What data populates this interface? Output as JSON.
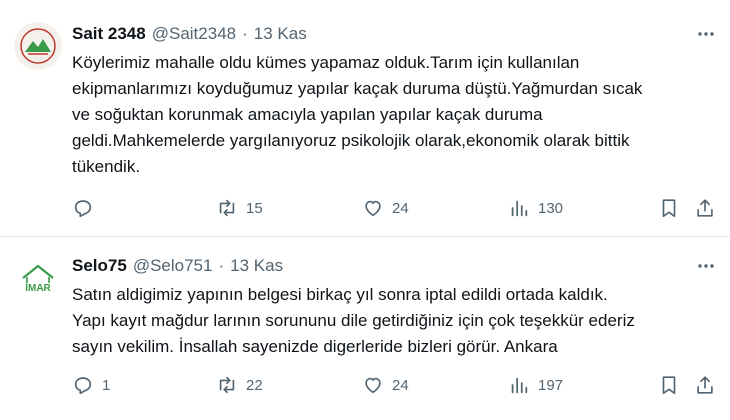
{
  "tweets": [
    {
      "name": "Sait 2348",
      "handle": "@Sait2348",
      "separator": "·",
      "time": "13 Kas",
      "text": "Köylerimiz mahalle oldu kümes yapamaz olduk.Tarım için kullanılan\nekipmanlarımızı koyduğumuz yapılar kaçak duruma düştü.Yağmurdan sıcak\nve soğuktan korunmak amacıyla yapılan yapılar kaçak duruma\ngeldi.Mahkemelerde yargılanıyoruz psikolojik olarak,ekonomik olarak bittik\ntükendik.",
      "reply_count": "",
      "retweet_count": "15",
      "like_count": "24",
      "view_count": "130"
    },
    {
      "name": "Selo75",
      "handle": "@Selo751",
      "separator": "·",
      "time": "13 Kas",
      "avatar_text": "İMAR",
      "text": "Satın aldigimiz yapının belgesi birkaç yıl sonra iptal edildi ortada kaldık.\nYapı kayıt mağdur larının sorununu dile getirdiğiniz için çok teşekkür ederiz\nsayın vekilim. İnsallah sayenizde digerleride bizleri görür. Ankara",
      "reply_count": "1",
      "retweet_count": "22",
      "like_count": "24",
      "view_count": "197"
    }
  ],
  "icons": {
    "more": "more-horizontal-icon",
    "reply": "reply-icon",
    "retweet": "retweet-icon",
    "like": "like-icon",
    "views": "views-icon",
    "bookmark": "bookmark-icon",
    "share": "share-icon"
  },
  "colors": {
    "text": "#0f1419",
    "muted": "#536471",
    "divider": "#e4e8eb",
    "avatar_green": "#3a9a4a",
    "avatar_red": "#c0392b"
  }
}
